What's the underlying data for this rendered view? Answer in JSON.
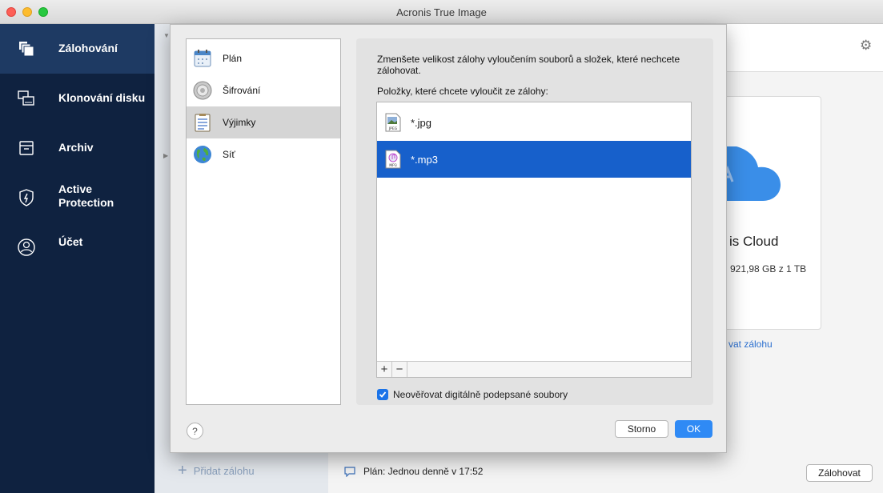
{
  "window": {
    "title": "Acronis True Image"
  },
  "sidebar": {
    "items": [
      {
        "label": "Zálohování",
        "icon": "backup-icon",
        "active": true
      },
      {
        "label": "Klonování disku",
        "icon": "clone-disk-icon"
      },
      {
        "label": "Archiv",
        "icon": "archive-icon"
      },
      {
        "label": "Active\nProtection",
        "icon": "shield-icon"
      },
      {
        "label": "Účet",
        "icon": "account-icon"
      }
    ]
  },
  "background": {
    "cloud_name": "is Cloud",
    "cloud_size": "921,98 GB z 1 TB",
    "change_link": "vat zálohu",
    "add_backup": "Přidat zálohu",
    "schedule": "Plán: Jednou denně v 17:52",
    "backup_button": "Zálohovat"
  },
  "dialog": {
    "categories": [
      {
        "label": "Plán",
        "icon": "calendar-icon"
      },
      {
        "label": "Šifrování",
        "icon": "encryption-icon"
      },
      {
        "label": "Výjimky",
        "icon": "exclusions-icon",
        "selected": true
      },
      {
        "label": "Síť",
        "icon": "globe-icon"
      }
    ],
    "description": "Zmenšete velikost zálohy vyloučením souborů a složek, které nechcete zálohovat.",
    "items_label": "Položky, které chcete vyloučit ze zálohy:",
    "exclusions": [
      {
        "label": "*.jpg",
        "icon": "jpeg-file-icon"
      },
      {
        "label": "*.mp3",
        "icon": "mp3-file-icon",
        "selected": true
      }
    ],
    "checkbox_label": "Neověřovat digitálně podepsané soubory",
    "checkbox_checked": true,
    "help_label": "?",
    "cancel_label": "Storno",
    "ok_label": "OK"
  },
  "colors": {
    "sidebar_bg": "#0f2240",
    "selection": "#1760cb",
    "ok_button": "#2f8af5"
  }
}
